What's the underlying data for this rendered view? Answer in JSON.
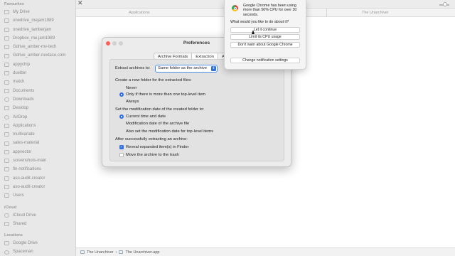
{
  "sidebar": {
    "sections": [
      {
        "title": "Favourites",
        "items": [
          {
            "label": "My Drive",
            "icon": "folder-icon"
          },
          {
            "label": "onedrive_mejam1989",
            "icon": "folder-icon"
          },
          {
            "label": "onedrive_lamberjam",
            "icon": "folder-icon"
          },
          {
            "label": "Dropbox_me.jam1989",
            "icon": "folder-icon"
          },
          {
            "label": "Gdrive_amber-mv-tech",
            "icon": "folder-icon"
          },
          {
            "label": "Gdrive_amber-nextaso-com",
            "icon": "folder-icon"
          },
          {
            "label": "appychip",
            "icon": "folder-icon"
          },
          {
            "label": "duelbin",
            "icon": "folder-icon"
          },
          {
            "label": "match",
            "icon": "folder-icon"
          },
          {
            "label": "Documents",
            "icon": "document-icon"
          },
          {
            "label": "Downloads",
            "icon": "download-icon"
          },
          {
            "label": "Desktop",
            "icon": "desktop-icon"
          },
          {
            "label": "AirDrop",
            "icon": "airdrop-icon"
          },
          {
            "label": "Applications",
            "icon": "applications-icon"
          },
          {
            "label": "multivariate",
            "icon": "folder-icon"
          },
          {
            "label": "sales-material",
            "icon": "folder-icon"
          },
          {
            "label": "appvector",
            "icon": "folder-icon"
          },
          {
            "label": "screenshots-main",
            "icon": "folder-icon"
          },
          {
            "label": "fin-notifications",
            "icon": "folder-icon"
          },
          {
            "label": "aso-audit-creator",
            "icon": "folder-icon"
          },
          {
            "label": "aso-audit-creator",
            "icon": "folder-icon"
          },
          {
            "label": "Users",
            "icon": "folder-icon"
          }
        ]
      },
      {
        "title": "iCloud",
        "items": [
          {
            "label": "iCloud Drive",
            "icon": "cloud-icon"
          },
          {
            "label": "Shared",
            "icon": "shared-folder-icon"
          }
        ]
      },
      {
        "title": "Locations",
        "items": [
          {
            "label": "Google Drive",
            "icon": "drive-icon"
          },
          {
            "label": "Spaceman",
            "icon": "disk-icon"
          }
        ]
      }
    ]
  },
  "finder": {
    "col_name": "Applications",
    "col_right": "The Unarchiver",
    "path": [
      "The Unarchiver",
      "The Unarchiver.app"
    ]
  },
  "prefs": {
    "title": "Preferences",
    "tabs": [
      "Archive Formats",
      "Extraction",
      "Ac"
    ],
    "active_tab": "Extraction",
    "extract_label": "Extract archives to:",
    "extract_value": "Same folder as the archive",
    "folder_heading": "Create a new folder for the extracted files:",
    "folder_options": [
      "Never",
      "Only if there is more than one top-level item",
      "Always"
    ],
    "folder_selected": "Only if there is more than one top-level item",
    "date_heading": "Set the modification date of the created folder to:",
    "date_options": [
      "Current time and date",
      "Modification date of the archive file"
    ],
    "date_selected": "Current time and date",
    "date_check": "Also set the modification date for top-level items",
    "after_heading": "After successfully extracting an archive:",
    "after_checks": [
      {
        "label": "Reveal expanded item(s) in Finder",
        "checked": true
      },
      {
        "label": "Move the archive to the trash",
        "checked": false
      }
    ]
  },
  "notification": {
    "message": "Google Chrome has been using more than 50% CPU for over 30 seconds.",
    "question": "What would you like to do about it?",
    "buttons": [
      "Let it continue",
      "Limit its CPU usage",
      "Don't warn about Google Chrome",
      "Change notification settings"
    ]
  },
  "colors": {
    "accent": "#2f6fe0",
    "close_red": "#ff5f57"
  }
}
